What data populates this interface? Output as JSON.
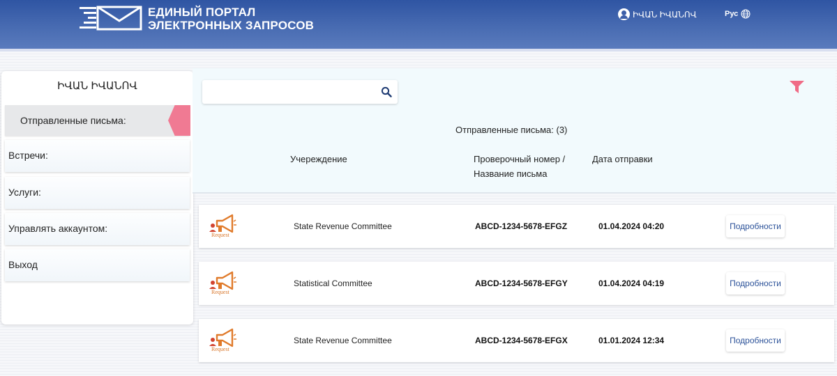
{
  "header": {
    "brand_line1": "ЕДИНЫЙ ПОРТАЛ",
    "brand_line2": "ЭЛЕКТРОННЫХ ЗАПРОСОВ",
    "user_name": "ԻՎԱՆ ԻՎԱՆՈՎ",
    "language": "Рус",
    "color": "#3d5fa8"
  },
  "sidebar": {
    "user_name": "ԻՎԱՆ ԻՎԱՆՈՎ",
    "items": [
      {
        "label": "Отправленные письма:",
        "active": true
      },
      {
        "label": "Встречи:"
      },
      {
        "label": "Услуги:"
      },
      {
        "label": "Управлять аккаунтом:"
      },
      {
        "label": "Выход"
      }
    ],
    "accent_color": "#f07a93"
  },
  "main": {
    "search": {
      "value": "",
      "placeholder": ""
    },
    "count_title": "Отправленные письма: (3)",
    "columns": {
      "institution": "Учереждение",
      "code_line1": "Проверочный номер /",
      "code_line2": "Название письма",
      "date": "Дата отправки"
    },
    "rows": [
      {
        "icon_label": "Request",
        "institution": "State Revenue Committee",
        "code": "ABCD-1234-5678-EFGZ",
        "date": "01.04.2024 04:20",
        "action": "Подробности"
      },
      {
        "icon_label": "Request",
        "institution": "Statistical Committee",
        "code": "ABCD-1234-5678-EFGY",
        "date": "01.04.2024 04:19",
        "action": "Подробности"
      },
      {
        "icon_label": "Request",
        "institution": "State Revenue Committee",
        "code": "ABCD-1234-5678-EFGX",
        "date": "01.01.2024 12:34",
        "action": "Подробности"
      }
    ]
  }
}
